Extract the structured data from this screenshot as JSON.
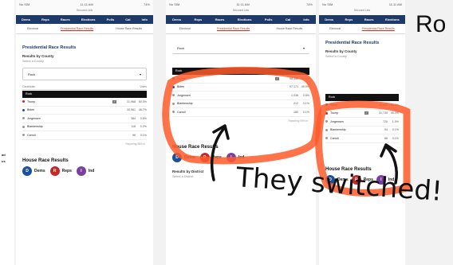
{
  "headline": "Ro",
  "annotation": "They switched!",
  "left_snippet": [
    "ad",
    "us"
  ],
  "phone": {
    "status_left": "No SIM",
    "status_time": "11:11 AM",
    "status_right": "74%",
    "url": "Secured Link",
    "nav": [
      "Dems",
      "Reps",
      "Races",
      "Elections",
      "Polls",
      "Cal",
      "Info"
    ],
    "subtabs": [
      "Electoral",
      "Presidential Race Results",
      "House Race Results"
    ]
  },
  "screen1": {
    "title": "Presidential Race Results",
    "results_by": "Results by County",
    "select_label": "Select a County",
    "selected": "Rock",
    "col_candidate": "Candidate",
    "col_votes": "Votes",
    "county_bar": "Rock",
    "rows": [
      {
        "name": "Trump",
        "votes": "31,968",
        "pct": "50.3%",
        "color": "#c62828",
        "winner": true
      },
      {
        "name": "Biden",
        "votes": "30,961",
        "pct": "48.7%",
        "color": "#1b4f9c",
        "winner": false
      },
      {
        "name": "Jorgensen",
        "votes": "384",
        "pct": "0.6%",
        "color": "#999999",
        "winner": false
      },
      {
        "name": "Blankenship",
        "votes": "118",
        "pct": "0.2%",
        "color": "#999999",
        "winner": false
      },
      {
        "name": "Carroll",
        "votes": "96",
        "pct": "0.1%",
        "color": "#999999",
        "winner": false
      }
    ],
    "reporting": "Reporting 98% in",
    "house_title": "House Race Results",
    "parties": [
      "Dems",
      "Reps",
      "Ind"
    ]
  },
  "screen2": {
    "selected": "Rock",
    "county_bar": "Rock",
    "rows": [
      {
        "name": "Trump",
        "votes": "98,449",
        "pct": "50.4%",
        "color": "#c62828",
        "winner": true
      },
      {
        "name": "Biden",
        "votes": "97,171",
        "pct": "49.0%",
        "color": "#1b4f9c",
        "winner": false
      },
      {
        "name": "Jorgensen",
        "votes": "1,036",
        "pct": "0.5%",
        "color": "#999999",
        "winner": false
      },
      {
        "name": "Blankenship",
        "votes": "212",
        "pct": "0.1%",
        "color": "#999999",
        "winner": false
      },
      {
        "name": "Carroll",
        "votes": "180",
        "pct": "0.1%",
        "color": "#999999",
        "winner": false
      }
    ],
    "reporting": "Reporting 99% in",
    "house_title": "House Race Results",
    "parties": [
      "Dems",
      "Reps",
      "Ind"
    ],
    "by_district": "Results by District",
    "district_note": "Select a District"
  },
  "screen3": {
    "title": "Presidential Race Results",
    "results_by": "Results by County",
    "select_label": "Select a County",
    "county_bar": "Rock",
    "rows": [
      {
        "name": "Biden",
        "votes": "38,419",
        "pct": "54.5%",
        "color": "#1b4f9c",
        "winner": false
      },
      {
        "name": "Trump",
        "votes": "31,730",
        "pct": "45.0%",
        "color": "#c62828",
        "winner": true
      },
      {
        "name": "Jorgensen",
        "votes": "720",
        "pct": "1.0%",
        "color": "#999999",
        "winner": false
      },
      {
        "name": "Blankenship",
        "votes": "94",
        "pct": "0.1%",
        "color": "#999999",
        "winner": false
      },
      {
        "name": "Carroll",
        "votes": "88",
        "pct": "0.1%",
        "color": "#999999",
        "winner": false
      }
    ],
    "house_title": "House Race Results",
    "parties": [
      "Dems",
      "Reps",
      "Ind"
    ]
  }
}
